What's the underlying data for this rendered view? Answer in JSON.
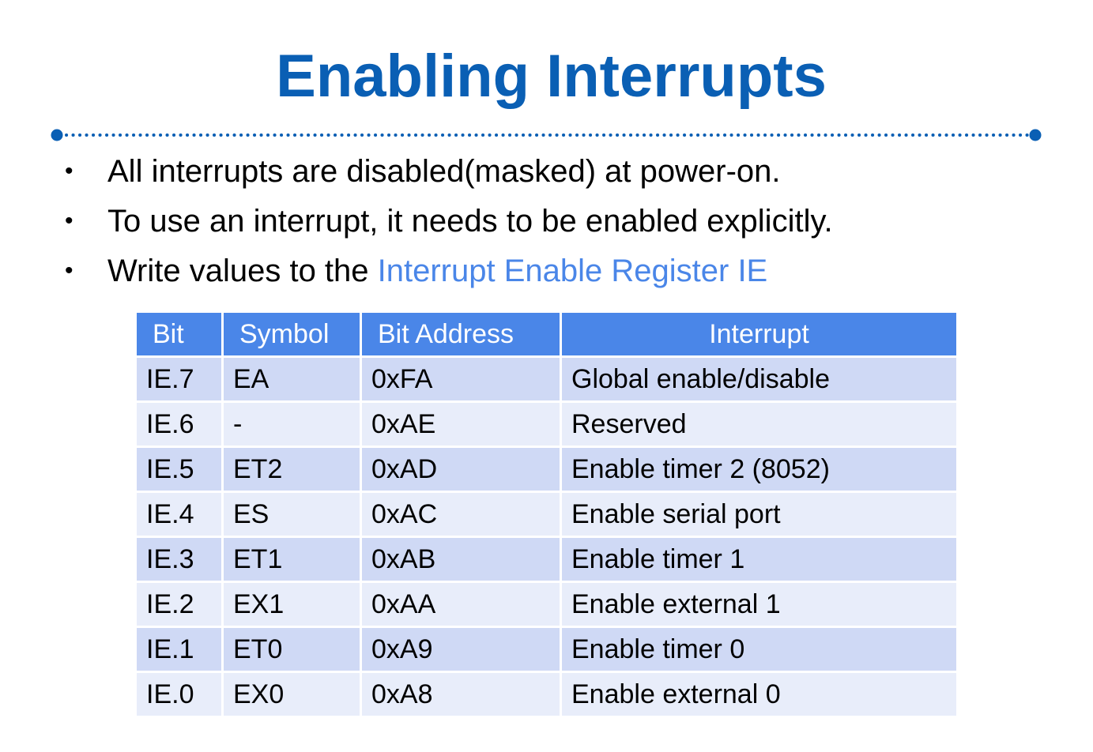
{
  "title": "Enabling Interrupts",
  "colors": {
    "title": "#0a5fb4",
    "highlight": "#4a86e8",
    "header_bg": "#4a86e8",
    "row_odd": "#cfd9f5",
    "row_even": "#e8edfa"
  },
  "bullets": [
    {
      "text": "All interrupts are disabled(masked) at power-on.",
      "highlight": ""
    },
    {
      "text": "To use an interrupt, it needs to be enabled explicitly.",
      "highlight": ""
    },
    {
      "text": "Write values to the ",
      "highlight": "Interrupt Enable Register IE"
    }
  ],
  "table": {
    "headers": [
      "Bit",
      "Symbol",
      "Bit Address",
      "Interrupt"
    ],
    "rows": [
      [
        "IE.7",
        "EA",
        "0xFA",
        "Global enable/disable"
      ],
      [
        "IE.6",
        "-",
        "0xAE",
        "Reserved"
      ],
      [
        "IE.5",
        "ET2",
        "0xAD",
        "Enable timer 2 (8052)"
      ],
      [
        "IE.4",
        "ES",
        "0xAC",
        "Enable serial port"
      ],
      [
        "IE.3",
        "ET1",
        "0xAB",
        "Enable timer 1"
      ],
      [
        "IE.2",
        "EX1",
        "0xAA",
        "Enable external 1"
      ],
      [
        "IE.1",
        "ET0",
        "0xA9",
        "Enable timer 0"
      ],
      [
        "IE.0",
        "EX0",
        "0xA8",
        "Enable external 0"
      ]
    ]
  }
}
